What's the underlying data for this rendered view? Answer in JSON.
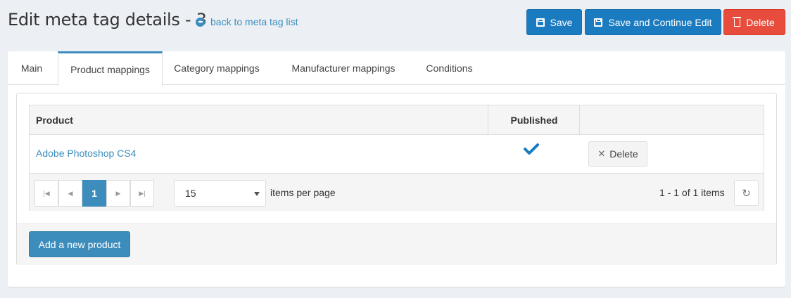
{
  "header": {
    "title": "Edit meta tag details - 3",
    "back_link": "back to meta tag list"
  },
  "toolbar": {
    "save_label": "Save",
    "save_continue_label": "Save and Continue Edit",
    "delete_label": "Delete"
  },
  "tabs": [
    {
      "label": "Main"
    },
    {
      "label": "Product mappings",
      "active": true
    },
    {
      "label": "Category mappings"
    },
    {
      "label": "Manufacturer mappings"
    },
    {
      "label": "Conditions"
    }
  ],
  "grid": {
    "columns": [
      "Product",
      "Published",
      ""
    ],
    "rows": [
      {
        "product": "Adobe Photoshop CS4",
        "published": true,
        "action": "Delete"
      }
    ],
    "pager": {
      "current_page": "1",
      "page_size": "15",
      "items_per_page_label": "items per page",
      "info": "1 - 1 of 1 items"
    }
  },
  "add_button": "Add a new product",
  "colors": {
    "primary": "#3c8dbc",
    "save": "#1a7bc0",
    "danger": "#e74c3c"
  }
}
